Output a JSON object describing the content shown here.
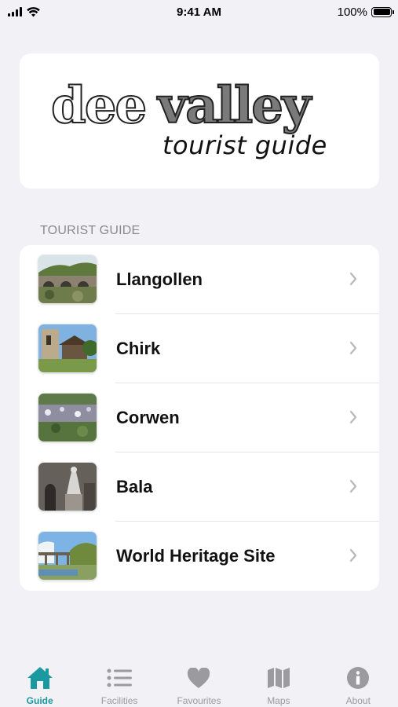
{
  "status_bar": {
    "time": "9:41 AM",
    "battery": "100%"
  },
  "logo": {
    "line1_left": "dee",
    "line1_right": "valley",
    "line2": "tourist guide"
  },
  "section": {
    "title": "TOURIST GUIDE"
  },
  "guide_items": [
    {
      "label": "Llangollen",
      "thumb": "bridge-river-photo"
    },
    {
      "label": "Chirk",
      "thumb": "church-gate-photo"
    },
    {
      "label": "Corwen",
      "thumb": "town-valley-photo"
    },
    {
      "label": "Bala",
      "thumb": "statue-photo"
    },
    {
      "label": "World Heritage Site",
      "thumb": "aqueduct-photo"
    }
  ],
  "tabs": [
    {
      "label": "Guide",
      "icon": "house-icon",
      "active": true
    },
    {
      "label": "Facilities",
      "icon": "list-icon",
      "active": false
    },
    {
      "label": "Favourites",
      "icon": "heart-icon",
      "active": false
    },
    {
      "label": "Maps",
      "icon": "map-icon",
      "active": false
    },
    {
      "label": "About",
      "icon": "info-icon",
      "active": false
    }
  ],
  "colors": {
    "accent": "#1a9aa0",
    "inactive": "#9a9a9f",
    "background": "#f1f1f6"
  }
}
